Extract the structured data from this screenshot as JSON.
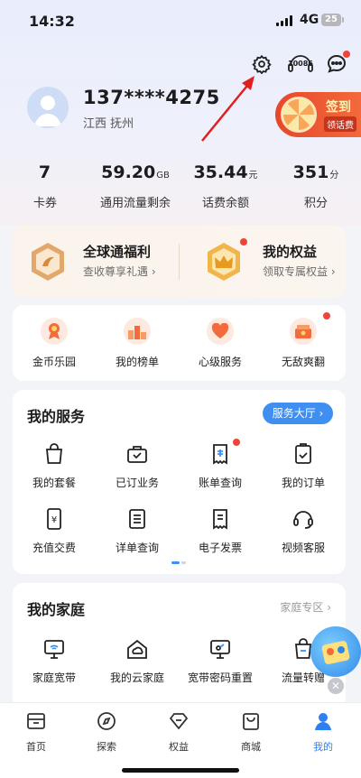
{
  "status_bar": {
    "time": "14:32",
    "network": "4G",
    "battery": "25"
  },
  "header": {
    "settings_icon": "gear-icon",
    "service_icon_text": "10086",
    "message_icon": "message-icon"
  },
  "profile": {
    "phone": "137****4275",
    "location": "江西 抚州",
    "signin_title": "签到",
    "signin_sub": "领话费"
  },
  "stats": [
    {
      "value": "7",
      "unit": "",
      "label": "卡券"
    },
    {
      "value": "59.20",
      "unit": "GB",
      "label": "通用流量剩余"
    },
    {
      "value": "35.44",
      "unit": "元",
      "label": "话费余额"
    },
    {
      "value": "351",
      "unit": "分",
      "label": "积分"
    }
  ],
  "welfare": {
    "left": {
      "title": "全球通福利",
      "sub": "查收尊享礼遇 ›"
    },
    "right": {
      "title": "我的权益",
      "sub": "领取专属权益 ›"
    }
  },
  "shortcuts": [
    {
      "label": "金币乐园",
      "icon": "coin-icon"
    },
    {
      "label": "我的榜单",
      "icon": "podium-icon"
    },
    {
      "label": "心级服务",
      "icon": "heart-icon"
    },
    {
      "label": "无敌爽翻",
      "icon": "gift-icon"
    }
  ],
  "services": {
    "title": "我的服务",
    "hall_button": "服务大厅 ›",
    "items": [
      {
        "label": "我的套餐",
        "icon": "bag-icon"
      },
      {
        "label": "已订业务",
        "icon": "briefcase-icon"
      },
      {
        "label": "账单查询",
        "icon": "bill-icon"
      },
      {
        "label": "我的订单",
        "icon": "order-icon"
      },
      {
        "label": "充值交费",
        "icon": "recharge-icon"
      },
      {
        "label": "详单查询",
        "icon": "list-icon"
      },
      {
        "label": "电子发票",
        "icon": "invoice-icon"
      },
      {
        "label": "视频客服",
        "icon": "headset-icon"
      }
    ]
  },
  "family": {
    "title": "我的家庭",
    "zone_link": "家庭专区 ›",
    "items": [
      {
        "label": "家庭宽带",
        "icon": "wifi-screen-icon"
      },
      {
        "label": "我的云家庭",
        "icon": "cloud-home-icon"
      },
      {
        "label": "宽带密码重置",
        "icon": "key-screen-icon"
      },
      {
        "label": "流量转赠",
        "icon": "transfer-icon"
      }
    ]
  },
  "tabbar": [
    {
      "label": "首页",
      "icon": "home-icon"
    },
    {
      "label": "探索",
      "icon": "compass-icon"
    },
    {
      "label": "权益",
      "icon": "diamond-icon"
    },
    {
      "label": "商城",
      "icon": "shop-bag-icon"
    },
    {
      "label": "我的",
      "icon": "person-icon",
      "active": true
    }
  ],
  "colors": {
    "accent": "#3f8ff0",
    "badge": "#f04438",
    "signin": "#e7472b"
  }
}
